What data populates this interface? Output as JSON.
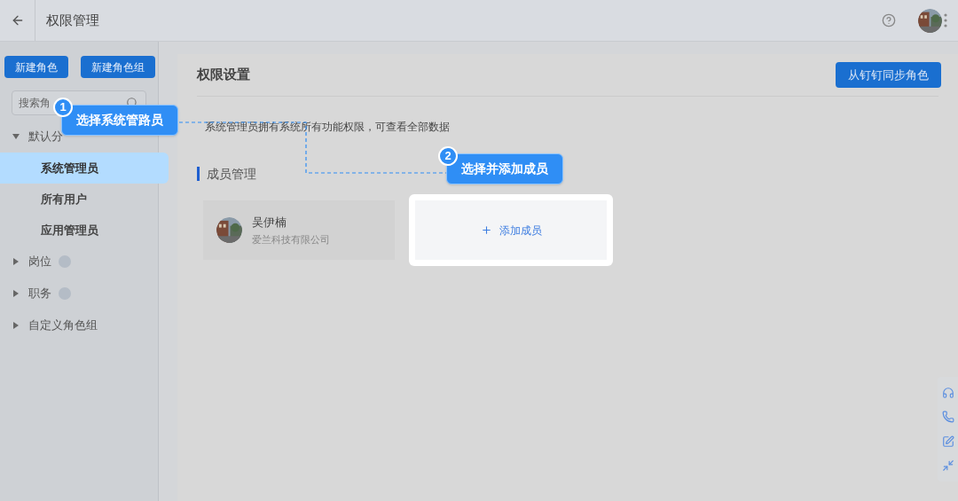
{
  "header": {
    "title": "权限管理"
  },
  "sidebar": {
    "buttons": [
      "新建角色",
      "新建角色组"
    ],
    "search": {
      "placeholder": "搜索角"
    },
    "groups": [
      {
        "label": "默认分",
        "expanded": true,
        "badge": false,
        "children": [
          {
            "label": "系统管理员",
            "selected": true
          },
          {
            "label": "所有用户",
            "selected": false
          },
          {
            "label": "应用管理员",
            "selected": false
          }
        ]
      },
      {
        "label": "岗位",
        "expanded": false,
        "badge": true
      },
      {
        "label": "职务",
        "expanded": false,
        "badge": true
      },
      {
        "label": "自定义角色组",
        "expanded": false,
        "badge": false
      }
    ]
  },
  "main": {
    "title": "权限设置",
    "sync_button": "从钉钉同步角色",
    "description": "系统管理员拥有系统所有功能权限，可查看全部数据",
    "section_title": "成员管理",
    "members": [
      {
        "name": "吴伊楠",
        "company": "爱兰科技有限公司"
      }
    ],
    "add_member": "添加成员"
  },
  "callouts": [
    {
      "number": "1",
      "text": "选择系统管路员"
    },
    {
      "number": "2",
      "text": "选择并添加成员"
    }
  ]
}
